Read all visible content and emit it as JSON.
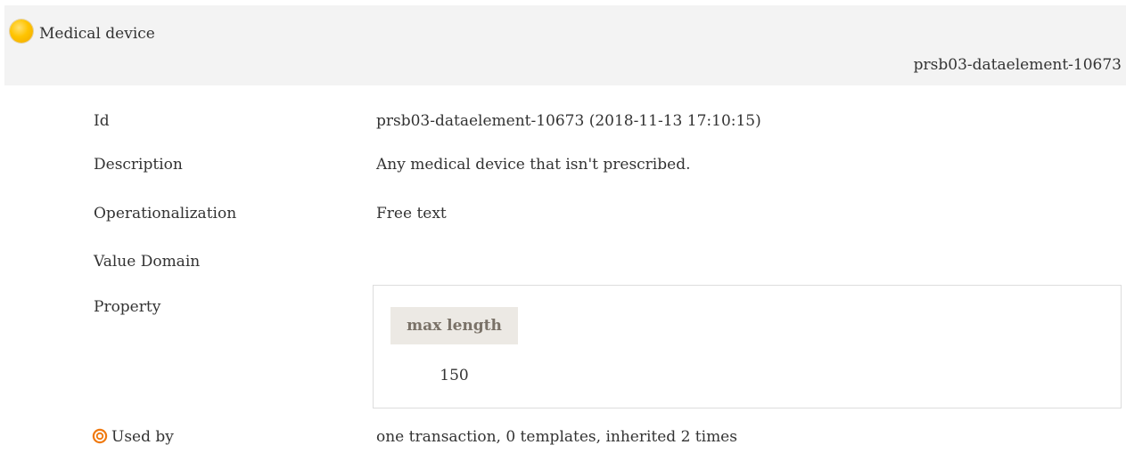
{
  "header": {
    "status_icon": "status-draft-yellow-circle",
    "status_color": "#ffc400",
    "title": "Medical device",
    "id": "prsb03-dataelement-10673"
  },
  "rows": {
    "id": {
      "label": "Id",
      "value": "prsb03-dataelement-10673 (2018-11-13 17:10:15)"
    },
    "description": {
      "label": "Description",
      "value": "Any medical device that isn't prescribed."
    },
    "operationalization": {
      "label": "Operationalization",
      "value": "Free text"
    },
    "value_domain": {
      "label": "Value Domain"
    },
    "property": {
      "label": "Property",
      "column_header": "max length",
      "column_value": "150"
    },
    "used_by": {
      "icon": "target-icon",
      "icon_color": "#f07a10",
      "label": "Used by",
      "value": "one transaction, 0 templates, inherited 2 times"
    }
  }
}
